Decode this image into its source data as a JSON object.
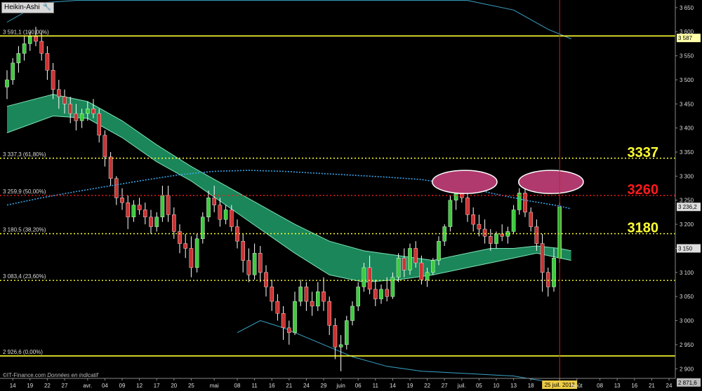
{
  "chart_title": "Heikin-Ashi",
  "footer": {
    "copyright": "©IT-Finance.com",
    "note": "Données en indicatif"
  },
  "colors": {
    "background": "#000000",
    "bull": "#3dcc3d",
    "bear": "#cc3333",
    "band_fill": "#1e9e6a",
    "band_edge": "#7fe3b5",
    "bollinger": "#3aa5c8",
    "mid_dotted": "#3aa5e8",
    "fib_line": "#ffff33",
    "fib_red": "#ff1a1a",
    "ellipse_fill": "#b03a6e",
    "cursor_line": "#cc2222"
  },
  "chart_data": {
    "type": "candlestick",
    "style": "heikin-ashi",
    "ylim": [
      2880,
      3660
    ],
    "y_ticks": [
      "3 650",
      "3 600",
      "3 550",
      "3 500",
      "3 450",
      "3 400",
      "3 350",
      "3 300",
      "3 250",
      "3 200",
      "3 150",
      "3 100",
      "3 050",
      "3 000",
      "2 950",
      "2 900"
    ],
    "y_tick_values": [
      3650,
      3600,
      3550,
      3500,
      3450,
      3400,
      3350,
      3300,
      3250,
      3200,
      3150,
      3100,
      3050,
      3000,
      2950,
      2900
    ],
    "x_ticks": [
      {
        "label": "14",
        "i": 1
      },
      {
        "label": "19",
        "i": 4
      },
      {
        "label": "22",
        "i": 7
      },
      {
        "label": "27",
        "i": 10
      },
      {
        "label": "avr.",
        "i": 14
      },
      {
        "label": "04",
        "i": 17
      },
      {
        "label": "09",
        "i": 20
      },
      {
        "label": "12",
        "i": 23
      },
      {
        "label": "17",
        "i": 26
      },
      {
        "label": "20",
        "i": 29
      },
      {
        "label": "25",
        "i": 32
      },
      {
        "label": "mai",
        "i": 36
      },
      {
        "label": "08",
        "i": 40
      },
      {
        "label": "11",
        "i": 43
      },
      {
        "label": "16",
        "i": 46
      },
      {
        "label": "21",
        "i": 49
      },
      {
        "label": "24",
        "i": 52
      },
      {
        "label": "29",
        "i": 55
      },
      {
        "label": "juin",
        "i": 58
      },
      {
        "label": "06",
        "i": 61
      },
      {
        "label": "11",
        "i": 64
      },
      {
        "label": "14",
        "i": 67
      },
      {
        "label": "19",
        "i": 70
      },
      {
        "label": "22",
        "i": 73
      },
      {
        "label": "27",
        "i": 76
      },
      {
        "label": "juil.",
        "i": 79
      },
      {
        "label": "05",
        "i": 82
      },
      {
        "label": "10",
        "i": 85
      },
      {
        "label": "13",
        "i": 88
      },
      {
        "label": "18",
        "i": 91
      },
      {
        "label": "25 juil. 2012",
        "i": 96
      },
      {
        "label": "août",
        "i": 99
      },
      {
        "label": "08",
        "i": 103
      },
      {
        "label": "13",
        "i": 106
      },
      {
        "label": "16",
        "i": 109
      },
      {
        "label": "21",
        "i": 112
      },
      {
        "label": "24",
        "i": 115
      }
    ],
    "candles": [
      [
        3485,
        3520,
        3460,
        3500
      ],
      [
        3500,
        3545,
        3490,
        3535
      ],
      [
        3535,
        3570,
        3515,
        3555
      ],
      [
        3555,
        3590,
        3540,
        3575
      ],
      [
        3575,
        3600,
        3560,
        3590
      ],
      [
        3590,
        3610,
        3570,
        3580
      ],
      [
        3580,
        3600,
        3540,
        3555
      ],
      [
        3555,
        3570,
        3500,
        3520
      ],
      [
        3520,
        3535,
        3460,
        3480
      ],
      [
        3480,
        3500,
        3440,
        3465
      ],
      [
        3465,
        3480,
        3430,
        3450
      ],
      [
        3450,
        3465,
        3410,
        3430
      ],
      [
        3430,
        3450,
        3395,
        3415
      ],
      [
        3415,
        3440,
        3400,
        3430
      ],
      [
        3430,
        3455,
        3415,
        3440
      ],
      [
        3440,
        3460,
        3420,
        3430
      ],
      [
        3430,
        3440,
        3370,
        3385
      ],
      [
        3385,
        3395,
        3320,
        3340
      ],
      [
        3340,
        3350,
        3280,
        3295
      ],
      [
        3295,
        3300,
        3240,
        3255
      ],
      [
        3255,
        3275,
        3230,
        3245
      ],
      [
        3245,
        3260,
        3190,
        3215
      ],
      [
        3215,
        3250,
        3205,
        3240
      ],
      [
        3240,
        3255,
        3220,
        3230
      ],
      [
        3230,
        3245,
        3200,
        3215
      ],
      [
        3215,
        3230,
        3180,
        3195
      ],
      [
        3195,
        3225,
        3185,
        3215
      ],
      [
        3215,
        3280,
        3205,
        3260
      ],
      [
        3260,
        3280,
        3205,
        3220
      ],
      [
        3220,
        3235,
        3170,
        3185
      ],
      [
        3185,
        3200,
        3140,
        3160
      ],
      [
        3160,
        3180,
        3130,
        3150
      ],
      [
        3150,
        3175,
        3090,
        3110
      ],
      [
        3110,
        3180,
        3100,
        3170
      ],
      [
        3170,
        3225,
        3160,
        3215
      ],
      [
        3215,
        3270,
        3205,
        3255
      ],
      [
        3255,
        3280,
        3225,
        3240
      ],
      [
        3240,
        3255,
        3195,
        3210
      ],
      [
        3210,
        3240,
        3200,
        3230
      ],
      [
        3230,
        3240,
        3185,
        3195
      ],
      [
        3195,
        3210,
        3150,
        3165
      ],
      [
        3165,
        3180,
        3100,
        3125
      ],
      [
        3125,
        3150,
        3080,
        3095
      ],
      [
        3095,
        3160,
        3085,
        3140
      ],
      [
        3140,
        3155,
        3080,
        3100
      ],
      [
        3100,
        3115,
        3050,
        3070
      ],
      [
        3070,
        3085,
        3020,
        3040
      ],
      [
        3040,
        3055,
        3000,
        3015
      ],
      [
        3015,
        3030,
        2960,
        2985
      ],
      [
        2985,
        3000,
        2950,
        2975
      ],
      [
        2975,
        3060,
        2970,
        3040
      ],
      [
        3040,
        3085,
        3030,
        3070
      ],
      [
        3070,
        3080,
        3020,
        3040
      ],
      [
        3040,
        3060,
        3010,
        3030
      ],
      [
        3030,
        3080,
        3020,
        3060
      ],
      [
        3060,
        3090,
        3020,
        3040
      ],
      [
        3040,
        3050,
        2970,
        2990
      ],
      [
        2990,
        3005,
        2920,
        2945
      ],
      [
        2945,
        2970,
        2895,
        2950
      ],
      [
        2950,
        3010,
        2940,
        3000
      ],
      [
        3000,
        3040,
        2990,
        3030
      ],
      [
        3030,
        3080,
        3020,
        3070
      ],
      [
        3070,
        3120,
        3060,
        3110
      ],
      [
        3110,
        3135,
        3055,
        3065
      ],
      [
        3065,
        3085,
        3030,
        3045
      ],
      [
        3045,
        3075,
        3035,
        3065
      ],
      [
        3065,
        3090,
        3040,
        3050
      ],
      [
        3050,
        3100,
        3045,
        3090
      ],
      [
        3090,
        3140,
        3080,
        3130
      ],
      [
        3130,
        3150,
        3090,
        3105
      ],
      [
        3105,
        3160,
        3095,
        3150
      ],
      [
        3150,
        3165,
        3110,
        3120
      ],
      [
        3120,
        3135,
        3075,
        3085
      ],
      [
        3085,
        3110,
        3070,
        3100
      ],
      [
        3100,
        3130,
        3095,
        3125
      ],
      [
        3125,
        3175,
        3115,
        3165
      ],
      [
        3165,
        3200,
        3155,
        3195
      ],
      [
        3195,
        3260,
        3185,
        3250
      ],
      [
        3250,
        3275,
        3230,
        3265
      ],
      [
        3265,
        3290,
        3245,
        3255
      ],
      [
        3255,
        3265,
        3205,
        3220
      ],
      [
        3220,
        3235,
        3185,
        3200
      ],
      [
        3200,
        3220,
        3175,
        3190
      ],
      [
        3190,
        3210,
        3160,
        3175
      ],
      [
        3175,
        3190,
        3145,
        3160
      ],
      [
        3160,
        3185,
        3150,
        3180
      ],
      [
        3180,
        3200,
        3165,
        3175
      ],
      [
        3175,
        3195,
        3160,
        3185
      ],
      [
        3185,
        3240,
        3180,
        3230
      ],
      [
        3230,
        3275,
        3220,
        3265
      ],
      [
        3265,
        3280,
        3215,
        3225
      ],
      [
        3225,
        3235,
        3185,
        3195
      ],
      [
        3195,
        3210,
        3145,
        3160
      ],
      [
        3160,
        3180,
        3060,
        3100
      ],
      [
        3100,
        3110,
        3050,
        3070
      ],
      [
        3070,
        3150,
        3060,
        3130
      ],
      [
        3130,
        3245,
        3120,
        3236
      ]
    ],
    "fib_levels": [
      {
        "label": "3 591,1 (100,00%)",
        "value": 3591.1,
        "color": "#ffff33",
        "style": "solid"
      },
      {
        "label": "3 337,3 (61,80%)",
        "value": 3337.3,
        "color": "#ffff33",
        "style": "dotted"
      },
      {
        "label": "3 259,9 (50,00%)",
        "value": 3259.9,
        "color": "#ff1a1a",
        "style": "dotted"
      },
      {
        "label": "3 180,5 (38,20%)",
        "value": 3180.5,
        "color": "#ffff33",
        "style": "dotted"
      },
      {
        "label": "3 083,4 (23,60%)",
        "value": 3083.4,
        "color": "#ffff33",
        "style": "dotted"
      },
      {
        "label": "2 926,6 (0,00%)",
        "value": 2926.6,
        "color": "#ffff33",
        "style": "solid"
      }
    ],
    "annotations": [
      {
        "text": "3337",
        "value": 3337.3,
        "color": "#ffff33"
      },
      {
        "text": "3260",
        "value": 3259.9,
        "color": "#ff1a1a"
      },
      {
        "text": "3180",
        "value": 3180.5,
        "color": "#ffff33"
      }
    ],
    "price_tags": [
      {
        "text": "3 587",
        "value": 3587,
        "bg": "#ffffaa"
      },
      {
        "text": "3 236,2",
        "value": 3236.2,
        "bg": "#dddddd"
      },
      {
        "text": "3 150",
        "value": 3150,
        "bg": "#dddddd"
      },
      {
        "text": "2 871,6",
        "value": 2871.6,
        "bg": "#bbbbbb"
      }
    ],
    "cursor_index": 96,
    "ellipses": [
      {
        "cx_index": 79.5,
        "cy_value": 3288,
        "rx_days": 4.5,
        "ry_value": 24
      },
      {
        "cx_index": 94.5,
        "cy_value": 3288,
        "rx_days": 4.5,
        "ry_value": 24
      }
    ],
    "band_upper": [
      [
        0,
        3445
      ],
      [
        8,
        3470
      ],
      [
        14,
        3455
      ],
      [
        20,
        3415
      ],
      [
        26,
        3365
      ],
      [
        32,
        3320
      ],
      [
        38,
        3280
      ],
      [
        44,
        3240
      ],
      [
        50,
        3200
      ],
      [
        56,
        3165
      ],
      [
        62,
        3145
      ],
      [
        68,
        3135
      ],
      [
        74,
        3125
      ],
      [
        80,
        3140
      ],
      [
        84,
        3150
      ],
      [
        88,
        3150
      ],
      [
        92,
        3155
      ],
      [
        96,
        3150
      ],
      [
        98,
        3145
      ]
    ],
    "band_lower": [
      [
        0,
        3390
      ],
      [
        8,
        3425
      ],
      [
        14,
        3420
      ],
      [
        20,
        3380
      ],
      [
        26,
        3330
      ],
      [
        32,
        3290
      ],
      [
        38,
        3240
      ],
      [
        44,
        3190
      ],
      [
        50,
        3140
      ],
      [
        56,
        3095
      ],
      [
        62,
        3080
      ],
      [
        68,
        3085
      ],
      [
        74,
        3095
      ],
      [
        80,
        3110
      ],
      [
        84,
        3120
      ],
      [
        88,
        3130
      ],
      [
        92,
        3140
      ],
      [
        96,
        3130
      ],
      [
        98,
        3125
      ]
    ],
    "mid_dotted": [
      [
        0,
        3240
      ],
      [
        6,
        3255
      ],
      [
        12,
        3268
      ],
      [
        18,
        3280
      ],
      [
        24,
        3292
      ],
      [
        30,
        3303
      ],
      [
        36,
        3310
      ],
      [
        42,
        3312
      ],
      [
        48,
        3310
      ],
      [
        54,
        3306
      ],
      [
        60,
        3302
      ],
      [
        66,
        3298
      ],
      [
        72,
        3293
      ],
      [
        78,
        3282
      ],
      [
        84,
        3265
      ],
      [
        90,
        3250
      ],
      [
        96,
        3238
      ],
      [
        98,
        3232
      ]
    ],
    "boll_upper": [
      [
        0,
        3620
      ],
      [
        6,
        3660
      ],
      [
        12,
        3665
      ],
      [
        20,
        3665
      ],
      [
        40,
        3665
      ],
      [
        60,
        3665
      ],
      [
        80,
        3665
      ],
      [
        88,
        3645
      ],
      [
        94,
        3605
      ],
      [
        98,
        3585
      ]
    ],
    "boll_lower": [
      [
        40,
        2975
      ],
      [
        44,
        3000
      ],
      [
        48,
        2985
      ],
      [
        52,
        2965
      ],
      [
        56,
        2945
      ],
      [
        60,
        2925
      ],
      [
        66,
        2905
      ],
      [
        72,
        2895
      ],
      [
        80,
        2890
      ],
      [
        88,
        2885
      ],
      [
        94,
        2873
      ],
      [
        98,
        2872
      ]
    ]
  }
}
